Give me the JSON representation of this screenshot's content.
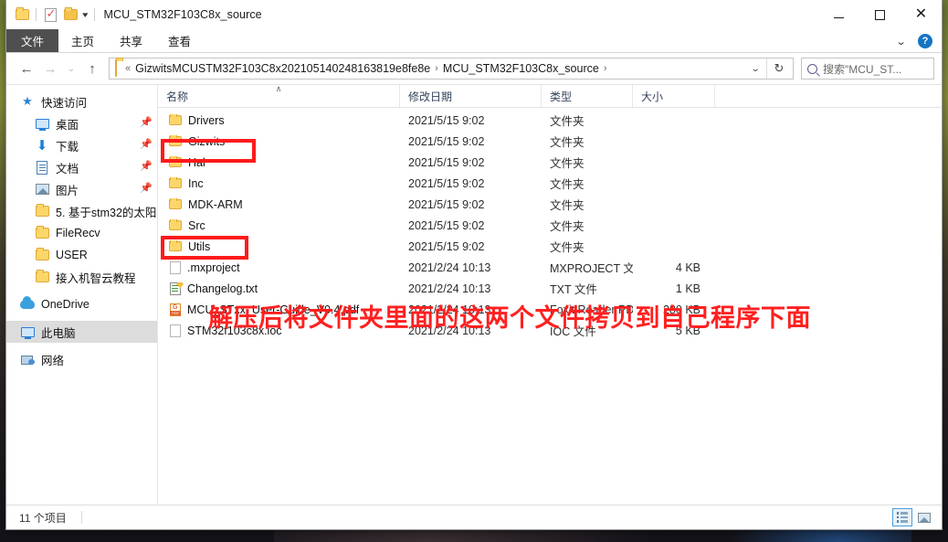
{
  "window": {
    "title": "MCU_STM32F103C8x_source",
    "controls": {
      "minimize": "—",
      "maximize": "□",
      "close": "✕"
    }
  },
  "quick_access_toolbar": {
    "caret": "▾"
  },
  "ribbon": {
    "tabs": [
      {
        "label": "文件",
        "active": true
      },
      {
        "label": "主页",
        "active": false
      },
      {
        "label": "共享",
        "active": false
      },
      {
        "label": "查看",
        "active": false
      }
    ],
    "collapse_caret": "⌄",
    "help_label": "?"
  },
  "address_bar": {
    "back": "←",
    "forward": "→",
    "recent_caret": "⌄",
    "up": "↑",
    "chevron": "«",
    "breadcrumbs": [
      "GizwitsMCUSTM32F103C8x202105140248163819e8fe8e",
      "MCU_STM32F103C8x_source"
    ],
    "separator": "›",
    "dropdown_caret": "⌄",
    "refresh": "↻"
  },
  "search": {
    "placeholder": "搜索\"MCU_ST...",
    "icon": "search-icon"
  },
  "sidebar": {
    "items": [
      {
        "label": "快速访问",
        "icon": "star-icon",
        "level": "root",
        "pinned": false,
        "selected": false
      },
      {
        "label": "桌面",
        "icon": "desktop-icon",
        "level": "child",
        "pinned": true,
        "selected": false
      },
      {
        "label": "下载",
        "icon": "download-icon",
        "level": "child",
        "pinned": true,
        "selected": false
      },
      {
        "label": "文档",
        "icon": "documents-icon",
        "level": "child",
        "pinned": true,
        "selected": false
      },
      {
        "label": "图片",
        "icon": "pictures-icon",
        "level": "child",
        "pinned": true,
        "selected": false
      },
      {
        "label": "5. 基于stm32的太阳",
        "icon": "folder-icon",
        "level": "child",
        "pinned": false,
        "selected": false
      },
      {
        "label": "FileRecv",
        "icon": "folder-icon",
        "level": "child",
        "pinned": false,
        "selected": false
      },
      {
        "label": "USER",
        "icon": "folder-icon",
        "level": "child",
        "pinned": false,
        "selected": false
      },
      {
        "label": "接入机智云教程",
        "icon": "folder-icon",
        "level": "child",
        "pinned": false,
        "selected": false
      },
      {
        "label": "OneDrive",
        "icon": "cloud-icon",
        "level": "root",
        "pinned": false,
        "selected": false
      },
      {
        "label": "此电脑",
        "icon": "computer-icon",
        "level": "root",
        "pinned": false,
        "selected": true
      },
      {
        "label": "网络",
        "icon": "network-icon",
        "level": "root",
        "pinned": false,
        "selected": false
      }
    ]
  },
  "file_list": {
    "columns": [
      {
        "key": "name",
        "label": "名称",
        "sorted": "asc",
        "sort_caret": "∧"
      },
      {
        "key": "date",
        "label": "修改日期",
        "sorted": "",
        "sort_caret": ""
      },
      {
        "key": "type",
        "label": "类型",
        "sorted": "",
        "sort_caret": ""
      },
      {
        "key": "size",
        "label": "大小",
        "sorted": "",
        "sort_caret": ""
      }
    ],
    "rows": [
      {
        "name": "Drivers",
        "date": "2021/5/15 9:02",
        "type": "文件夹",
        "size": "",
        "icon": "folder-icon"
      },
      {
        "name": "Gizwits",
        "date": "2021/5/15 9:02",
        "type": "文件夹",
        "size": "",
        "icon": "folder-icon"
      },
      {
        "name": "Hal",
        "date": "2021/5/15 9:02",
        "type": "文件夹",
        "size": "",
        "icon": "folder-icon"
      },
      {
        "name": "Inc",
        "date": "2021/5/15 9:02",
        "type": "文件夹",
        "size": "",
        "icon": "folder-icon"
      },
      {
        "name": "MDK-ARM",
        "date": "2021/5/15 9:02",
        "type": "文件夹",
        "size": "",
        "icon": "folder-icon"
      },
      {
        "name": "Src",
        "date": "2021/5/15 9:02",
        "type": "文件夹",
        "size": "",
        "icon": "folder-icon"
      },
      {
        "name": "Utils",
        "date": "2021/5/15 9:02",
        "type": "文件夹",
        "size": "",
        "icon": "folder-icon"
      },
      {
        "name": ".mxproject",
        "date": "2021/2/24 10:13",
        "type": "MXPROJECT 文件",
        "size": "4 KB",
        "icon": "file-icon"
      },
      {
        "name": "Changelog.txt",
        "date": "2021/2/24 10:13",
        "type": "TXT 文件",
        "size": "1 KB",
        "icon": "txt-icon"
      },
      {
        "name": "MCU_STxx_User-Guide_V0.4.pdf",
        "date": "2021/2/24 10:13",
        "type": "Foxit Reader PD...",
        "size": "280 KB",
        "icon": "pdf-icon"
      },
      {
        "name": "STM32f103c8x.ioc",
        "date": "2021/2/24 10:13",
        "type": "IOC 文件",
        "size": "5 KB",
        "icon": "file-icon"
      }
    ]
  },
  "status_bar": {
    "item_count": "11 个项目",
    "views": [
      {
        "name": "details-view",
        "active": true
      },
      {
        "name": "large-icons-view",
        "active": false
      }
    ]
  },
  "annotations": {
    "text": "解压后将文件夹里面的这两个文件拷贝到自己程序下面",
    "highlight_color": "#ff1a1a",
    "boxes": [
      {
        "target": "Gizwits"
      },
      {
        "target": "Utils"
      }
    ]
  }
}
